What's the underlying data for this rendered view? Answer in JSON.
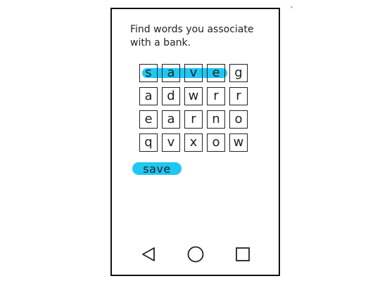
{
  "stray_mark": "`",
  "prompt": {
    "text": "Find words you associate with a bank."
  },
  "grid": {
    "rows": [
      [
        "s",
        "a",
        "v",
        "e",
        "g"
      ],
      [
        "a",
        "d",
        "w",
        "r",
        "r"
      ],
      [
        "e",
        "a",
        "r",
        "n",
        "o"
      ],
      [
        "q",
        "v",
        "x",
        "o",
        "w"
      ]
    ]
  },
  "found_words": [
    "save"
  ],
  "colors": {
    "highlight": "#1ec8f2",
    "ink": "#222222"
  },
  "icons": {
    "back": "triangle-back-icon",
    "home": "circle-home-icon",
    "recent": "square-recent-apps-icon"
  }
}
